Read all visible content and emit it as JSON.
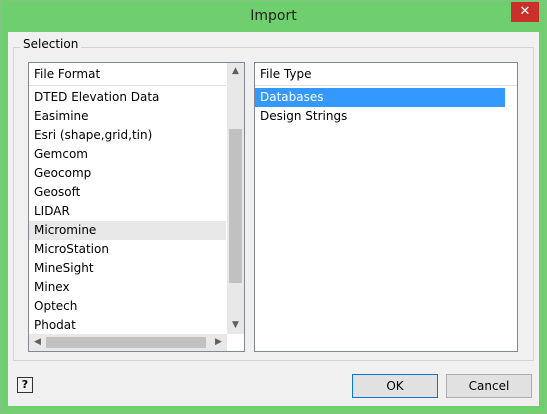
{
  "window": {
    "title": "Import",
    "close_glyph": "✕"
  },
  "selection": {
    "group_label": "Selection",
    "file_format": {
      "header": "File Format",
      "items": [
        "DTED Elevation Data",
        "Easimine",
        "Esri (shape,grid,tin)",
        "Gemcom",
        "Geocomp",
        "Geosoft",
        "LIDAR",
        "Micromine",
        "MicroStation",
        "MineSight",
        "Minex",
        "Optech",
        "Phodat"
      ],
      "highlighted": "Micromine"
    },
    "file_type": {
      "header": "File Type",
      "items": [
        "Databases",
        "Design Strings"
      ],
      "selected": "Databases"
    }
  },
  "buttons": {
    "ok": "OK",
    "cancel": "Cancel",
    "help_glyph": "?"
  },
  "colors": {
    "titlebar": "#6fcf6f",
    "selection": "#3399ff",
    "close": "#c9302c"
  }
}
